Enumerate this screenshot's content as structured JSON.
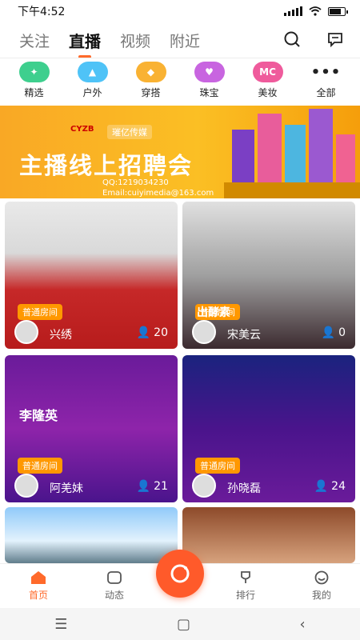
{
  "status": {
    "time": "下午4:52"
  },
  "tabs": [
    "关注",
    "直播",
    "视频",
    "附近"
  ],
  "active_tab": "直播",
  "categories": [
    {
      "label": "精选",
      "icon": "dancer-icon",
      "color": "#3ecf8e"
    },
    {
      "label": "户外",
      "icon": "tent-icon",
      "color": "#4fc3f7"
    },
    {
      "label": "穿搭",
      "icon": "graduation-cap-icon",
      "color": "#f9b233"
    },
    {
      "label": "珠宝",
      "icon": "hearts-icon",
      "color": "#c865e0"
    },
    {
      "label": "美妆",
      "icon_text": "MC",
      "color": "#ef5b9c"
    },
    {
      "label": "全部",
      "icon": "more-icon",
      "color": "#ffffff"
    }
  ],
  "banner": {
    "brand": "CYZB",
    "tag": "璀亿传媒",
    "title": "主播线上招聘会",
    "qq": "QQ:1219034230",
    "email": "Email:cuiyimedia@163.com"
  },
  "cards": [
    {
      "badge": "普通房间",
      "name": "兴绣",
      "count": "20",
      "overlay": ""
    },
    {
      "badge": "普通房间",
      "name": "宋美云",
      "count": "0",
      "overlay": "出酵素"
    },
    {
      "badge": "普通房间",
      "name": "阿羌妹",
      "count": "21",
      "overlay": "李隆英"
    },
    {
      "badge": "普通房间",
      "name": "孙晓磊",
      "count": "24",
      "overlay": ""
    }
  ],
  "bottom_nav": [
    "首页",
    "动态",
    "排行",
    "我的"
  ],
  "colors": {
    "accent": "#ff6a2b",
    "badge": "#ff9800"
  }
}
